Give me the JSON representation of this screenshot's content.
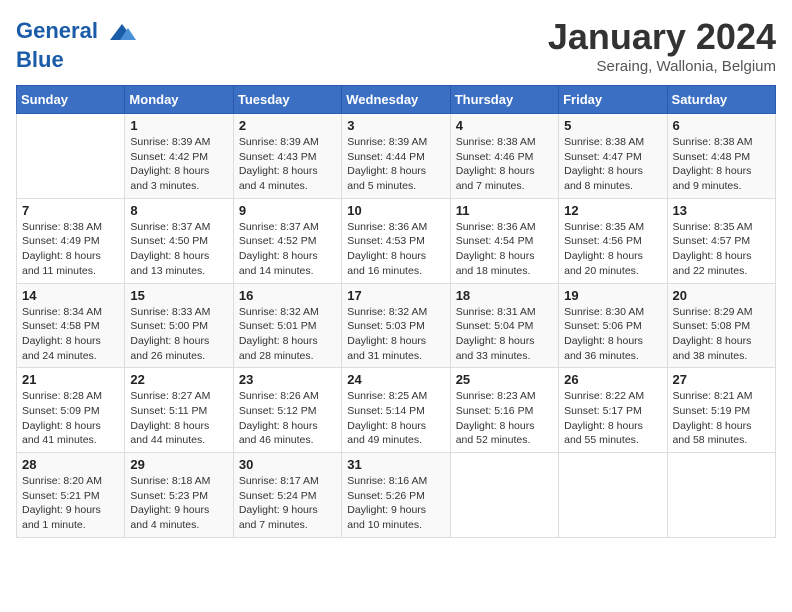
{
  "header": {
    "logo_line1": "General",
    "logo_line2": "Blue",
    "month_title": "January 2024",
    "subtitle": "Seraing, Wallonia, Belgium"
  },
  "weekdays": [
    "Sunday",
    "Monday",
    "Tuesday",
    "Wednesday",
    "Thursday",
    "Friday",
    "Saturday"
  ],
  "weeks": [
    [
      {
        "day": "",
        "info": ""
      },
      {
        "day": "1",
        "info": "Sunrise: 8:39 AM\nSunset: 4:42 PM\nDaylight: 8 hours\nand 3 minutes."
      },
      {
        "day": "2",
        "info": "Sunrise: 8:39 AM\nSunset: 4:43 PM\nDaylight: 8 hours\nand 4 minutes."
      },
      {
        "day": "3",
        "info": "Sunrise: 8:39 AM\nSunset: 4:44 PM\nDaylight: 8 hours\nand 5 minutes."
      },
      {
        "day": "4",
        "info": "Sunrise: 8:38 AM\nSunset: 4:46 PM\nDaylight: 8 hours\nand 7 minutes."
      },
      {
        "day": "5",
        "info": "Sunrise: 8:38 AM\nSunset: 4:47 PM\nDaylight: 8 hours\nand 8 minutes."
      },
      {
        "day": "6",
        "info": "Sunrise: 8:38 AM\nSunset: 4:48 PM\nDaylight: 8 hours\nand 9 minutes."
      }
    ],
    [
      {
        "day": "7",
        "info": "Sunrise: 8:38 AM\nSunset: 4:49 PM\nDaylight: 8 hours\nand 11 minutes."
      },
      {
        "day": "8",
        "info": "Sunrise: 8:37 AM\nSunset: 4:50 PM\nDaylight: 8 hours\nand 13 minutes."
      },
      {
        "day": "9",
        "info": "Sunrise: 8:37 AM\nSunset: 4:52 PM\nDaylight: 8 hours\nand 14 minutes."
      },
      {
        "day": "10",
        "info": "Sunrise: 8:36 AM\nSunset: 4:53 PM\nDaylight: 8 hours\nand 16 minutes."
      },
      {
        "day": "11",
        "info": "Sunrise: 8:36 AM\nSunset: 4:54 PM\nDaylight: 8 hours\nand 18 minutes."
      },
      {
        "day": "12",
        "info": "Sunrise: 8:35 AM\nSunset: 4:56 PM\nDaylight: 8 hours\nand 20 minutes."
      },
      {
        "day": "13",
        "info": "Sunrise: 8:35 AM\nSunset: 4:57 PM\nDaylight: 8 hours\nand 22 minutes."
      }
    ],
    [
      {
        "day": "14",
        "info": "Sunrise: 8:34 AM\nSunset: 4:58 PM\nDaylight: 8 hours\nand 24 minutes."
      },
      {
        "day": "15",
        "info": "Sunrise: 8:33 AM\nSunset: 5:00 PM\nDaylight: 8 hours\nand 26 minutes."
      },
      {
        "day": "16",
        "info": "Sunrise: 8:32 AM\nSunset: 5:01 PM\nDaylight: 8 hours\nand 28 minutes."
      },
      {
        "day": "17",
        "info": "Sunrise: 8:32 AM\nSunset: 5:03 PM\nDaylight: 8 hours\nand 31 minutes."
      },
      {
        "day": "18",
        "info": "Sunrise: 8:31 AM\nSunset: 5:04 PM\nDaylight: 8 hours\nand 33 minutes."
      },
      {
        "day": "19",
        "info": "Sunrise: 8:30 AM\nSunset: 5:06 PM\nDaylight: 8 hours\nand 36 minutes."
      },
      {
        "day": "20",
        "info": "Sunrise: 8:29 AM\nSunset: 5:08 PM\nDaylight: 8 hours\nand 38 minutes."
      }
    ],
    [
      {
        "day": "21",
        "info": "Sunrise: 8:28 AM\nSunset: 5:09 PM\nDaylight: 8 hours\nand 41 minutes."
      },
      {
        "day": "22",
        "info": "Sunrise: 8:27 AM\nSunset: 5:11 PM\nDaylight: 8 hours\nand 44 minutes."
      },
      {
        "day": "23",
        "info": "Sunrise: 8:26 AM\nSunset: 5:12 PM\nDaylight: 8 hours\nand 46 minutes."
      },
      {
        "day": "24",
        "info": "Sunrise: 8:25 AM\nSunset: 5:14 PM\nDaylight: 8 hours\nand 49 minutes."
      },
      {
        "day": "25",
        "info": "Sunrise: 8:23 AM\nSunset: 5:16 PM\nDaylight: 8 hours\nand 52 minutes."
      },
      {
        "day": "26",
        "info": "Sunrise: 8:22 AM\nSunset: 5:17 PM\nDaylight: 8 hours\nand 55 minutes."
      },
      {
        "day": "27",
        "info": "Sunrise: 8:21 AM\nSunset: 5:19 PM\nDaylight: 8 hours\nand 58 minutes."
      }
    ],
    [
      {
        "day": "28",
        "info": "Sunrise: 8:20 AM\nSunset: 5:21 PM\nDaylight: 9 hours\nand 1 minute."
      },
      {
        "day": "29",
        "info": "Sunrise: 8:18 AM\nSunset: 5:23 PM\nDaylight: 9 hours\nand 4 minutes."
      },
      {
        "day": "30",
        "info": "Sunrise: 8:17 AM\nSunset: 5:24 PM\nDaylight: 9 hours\nand 7 minutes."
      },
      {
        "day": "31",
        "info": "Sunrise: 8:16 AM\nSunset: 5:26 PM\nDaylight: 9 hours\nand 10 minutes."
      },
      {
        "day": "",
        "info": ""
      },
      {
        "day": "",
        "info": ""
      },
      {
        "day": "",
        "info": ""
      }
    ]
  ]
}
